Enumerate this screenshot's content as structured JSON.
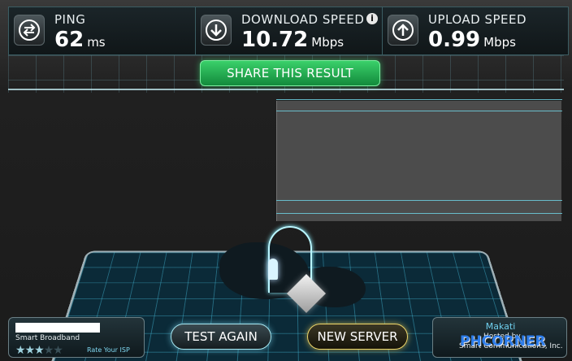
{
  "stats": {
    "ping": {
      "label": "PING",
      "value": "62",
      "unit": "ms",
      "icon": "swap-arrows-icon"
    },
    "download": {
      "label": "DOWNLOAD SPEED",
      "value": "10.72",
      "unit": "Mbps",
      "icon": "arrow-down-icon",
      "info": "i"
    },
    "upload": {
      "label": "UPLOAD SPEED",
      "value": "0.99",
      "unit": "Mbps",
      "icon": "arrow-up-icon"
    }
  },
  "actions": {
    "share_label": "SHARE THIS RESULT",
    "test_again_label": "TEST AGAIN",
    "new_server_label": "NEW SERVER"
  },
  "isp": {
    "name": "Smart Broadband",
    "rating_stars": 3,
    "rating_max": 5,
    "rate_label": "Rate Your ISP"
  },
  "server": {
    "city": "Makati",
    "hosted_by": "Hosted by",
    "company": "Smart Communications, Inc."
  },
  "watermark": {
    "text": "PHCORNER"
  },
  "colors": {
    "share_button": "#1fb050",
    "test_again_glow": "#a7e8f2",
    "new_server_glow": "#f1d86a",
    "accent": "#6fd0ee"
  }
}
